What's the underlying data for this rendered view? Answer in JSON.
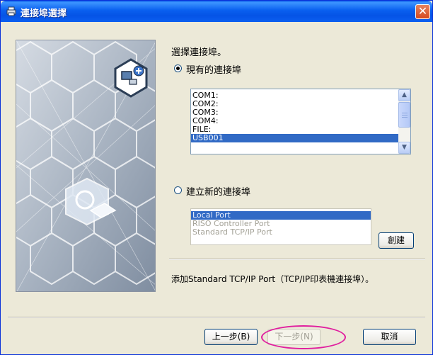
{
  "window": {
    "title": "連接埠選擇",
    "close_label": "✕"
  },
  "heading": "選擇連接埠。",
  "existing": {
    "label": "現有的連接埠",
    "items": [
      "COM1:",
      "COM2:",
      "COM3:",
      "COM4:",
      "FILE:",
      "USB001"
    ],
    "selected": "USB001"
  },
  "new_port": {
    "label": "建立新的連接埠",
    "items": [
      "Local Port",
      "RISO Controller Port",
      "Standard TCP/IP Port"
    ],
    "selected": "Local Port",
    "create_label": "創建"
  },
  "info_text": "添加Standard TCP/IP Port（TCP/IP印表機連接埠）。",
  "buttons": {
    "back": "上一步(B)",
    "next": "下一步(N)",
    "cancel": "取消"
  },
  "colors": {
    "titlebar": "#0a5ae8",
    "selection": "#316ac5",
    "highlight": "#e0209f"
  }
}
